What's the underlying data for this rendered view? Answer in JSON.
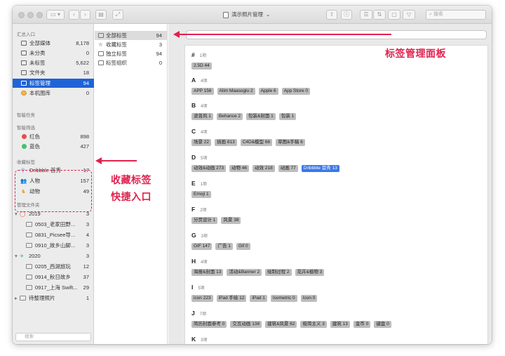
{
  "window": {
    "title": "演示照片管理",
    "search_placeholder": "搜索"
  },
  "sidebar": {
    "sections": [
      {
        "title": "汇总入口",
        "items": [
          {
            "label": "全部媒体",
            "count": "8,178",
            "icon": "photos-icon"
          },
          {
            "label": "未分类",
            "count": "0",
            "icon": "unsorted-icon"
          },
          {
            "label": "未标签",
            "count": "5,622",
            "icon": "untagged-icon"
          },
          {
            "label": "文件夹",
            "count": "18",
            "icon": "folder-icon"
          },
          {
            "label": "标签管理",
            "count": "94",
            "icon": "tag-manage-icon",
            "selected": true
          },
          {
            "label": "本机图库",
            "count": "0",
            "icon": "photo-library-icon"
          }
        ]
      },
      {
        "title": "智能任务",
        "items": []
      },
      {
        "title": "智能筛选",
        "items": [
          {
            "label": "红色",
            "count": "898",
            "color": "#e94b4b"
          },
          {
            "label": "蓝色",
            "count": "427",
            "color": "#3ec46a"
          }
        ]
      },
      {
        "title": "收藏标签",
        "items": [
          {
            "label": "Dribbble 首秀",
            "count": "17",
            "icon": "bike-icon",
            "color": "#5aa0e8"
          },
          {
            "label": "人物",
            "count": "157",
            "icon": "people-icon",
            "color": "#3a7bd5"
          },
          {
            "label": "动物",
            "count": "49",
            "icon": "animal-icon",
            "color": "#e8a530"
          }
        ]
      },
      {
        "title": "管理文件夹",
        "items": []
      }
    ],
    "folders": [
      {
        "label": "2019",
        "count": "3",
        "level": 0,
        "icon": "ring-icon"
      },
      {
        "label": "0503_老家田野...",
        "count": "3",
        "level": 1
      },
      {
        "label": "0831_Picsee导...",
        "count": "4",
        "level": 1
      },
      {
        "label": "0910_故乡山脚...",
        "count": "3",
        "level": 1
      },
      {
        "label": "2020",
        "count": "3",
        "level": 0,
        "icon": "plane-icon"
      },
      {
        "label": "0205_西湖旅玩",
        "count": "12",
        "level": 1
      },
      {
        "label": "0914_秋日故乡",
        "count": "37",
        "level": 1
      },
      {
        "label": "0917_上海 Swift...",
        "count": "29",
        "level": 1
      },
      {
        "label": "待整理照片",
        "count": "1",
        "level": 0,
        "icon": "folder-icon"
      }
    ],
    "search_placeholder": "搜索"
  },
  "taglist": [
    {
      "label": "全部标签",
      "count": "94",
      "selected": true
    },
    {
      "label": "收藏标签",
      "count": "3"
    },
    {
      "label": "独立标签",
      "count": "94"
    },
    {
      "label": "标签组织",
      "count": "0"
    }
  ],
  "groups": [
    {
      "letter": "#",
      "count": "1项",
      "tags": [
        {
          "t": "2.5D 44"
        }
      ]
    },
    {
      "letter": "A",
      "count": "4项",
      "tags": [
        {
          "t": "APP 156"
        },
        {
          "t": "Alim Maasoglu 2"
        },
        {
          "t": "Apple 6"
        },
        {
          "t": "App Store 0"
        }
      ]
    },
    {
      "letter": "B",
      "count": "4项",
      "tags": [
        {
          "t": "波普风 1"
        },
        {
          "t": "Behance 2"
        },
        {
          "t": "包装&封面 1"
        },
        {
          "t": "包装 1"
        }
      ]
    },
    {
      "letter": "C",
      "count": "4项",
      "tags": [
        {
          "t": "场景 22"
        },
        {
          "t": "插画 813"
        },
        {
          "t": "C4D&模型 66"
        },
        {
          "t": "草图&手稿 6"
        }
      ]
    },
    {
      "letter": "D",
      "count": "5项",
      "tags": [
        {
          "t": "动效&动画 273"
        },
        {
          "t": "动物 46"
        },
        {
          "t": "动效 218"
        },
        {
          "t": "动画 77"
        },
        {
          "t": "Dribbble 首秀 13",
          "active": true
        }
      ]
    },
    {
      "letter": "E",
      "count": "1项",
      "tags": [
        {
          "t": "Emoji 1"
        }
      ]
    },
    {
      "letter": "F",
      "count": "2项",
      "tags": [
        {
          "t": "分页设计 1"
        },
        {
          "t": "风景 38"
        }
      ]
    },
    {
      "letter": "G",
      "count": "3项",
      "tags": [
        {
          "t": "GIF 147"
        },
        {
          "t": "广告 1"
        },
        {
          "t": "Gif 0"
        }
      ]
    },
    {
      "letter": "H",
      "count": "4项",
      "tags": [
        {
          "t": "海报&封面 13"
        },
        {
          "t": "活动&Banner 2"
        },
        {
          "t": "绘制过程 2"
        },
        {
          "t": "花卉&植物 3"
        }
      ]
    },
    {
      "letter": "I",
      "count": "5项",
      "tags": [
        {
          "t": "icon 223"
        },
        {
          "t": "iPad 手绘 12"
        },
        {
          "t": "iPad 1"
        },
        {
          "t": "Isometric 0"
        },
        {
          "t": "Icon 0"
        }
      ]
    },
    {
      "letter": "J",
      "count": "7项",
      "tags": [
        {
          "t": "简历封面参考 0"
        },
        {
          "t": "交互动画 138"
        },
        {
          "t": "建筑&风景 62"
        },
        {
          "t": "极简主义 3"
        },
        {
          "t": "建筑 13"
        },
        {
          "t": "金币 0"
        },
        {
          "t": "键盘 0"
        }
      ]
    },
    {
      "letter": "K",
      "count": "3项",
      "tags": []
    }
  ],
  "annotations": {
    "panel": "标签管理面板",
    "favorites_line1": "收藏标签",
    "favorites_line2": "快捷入口"
  },
  "colors": {
    "accent": "#1f63d6",
    "annotation": "#e0224e",
    "chip": "#bdbdbd"
  }
}
